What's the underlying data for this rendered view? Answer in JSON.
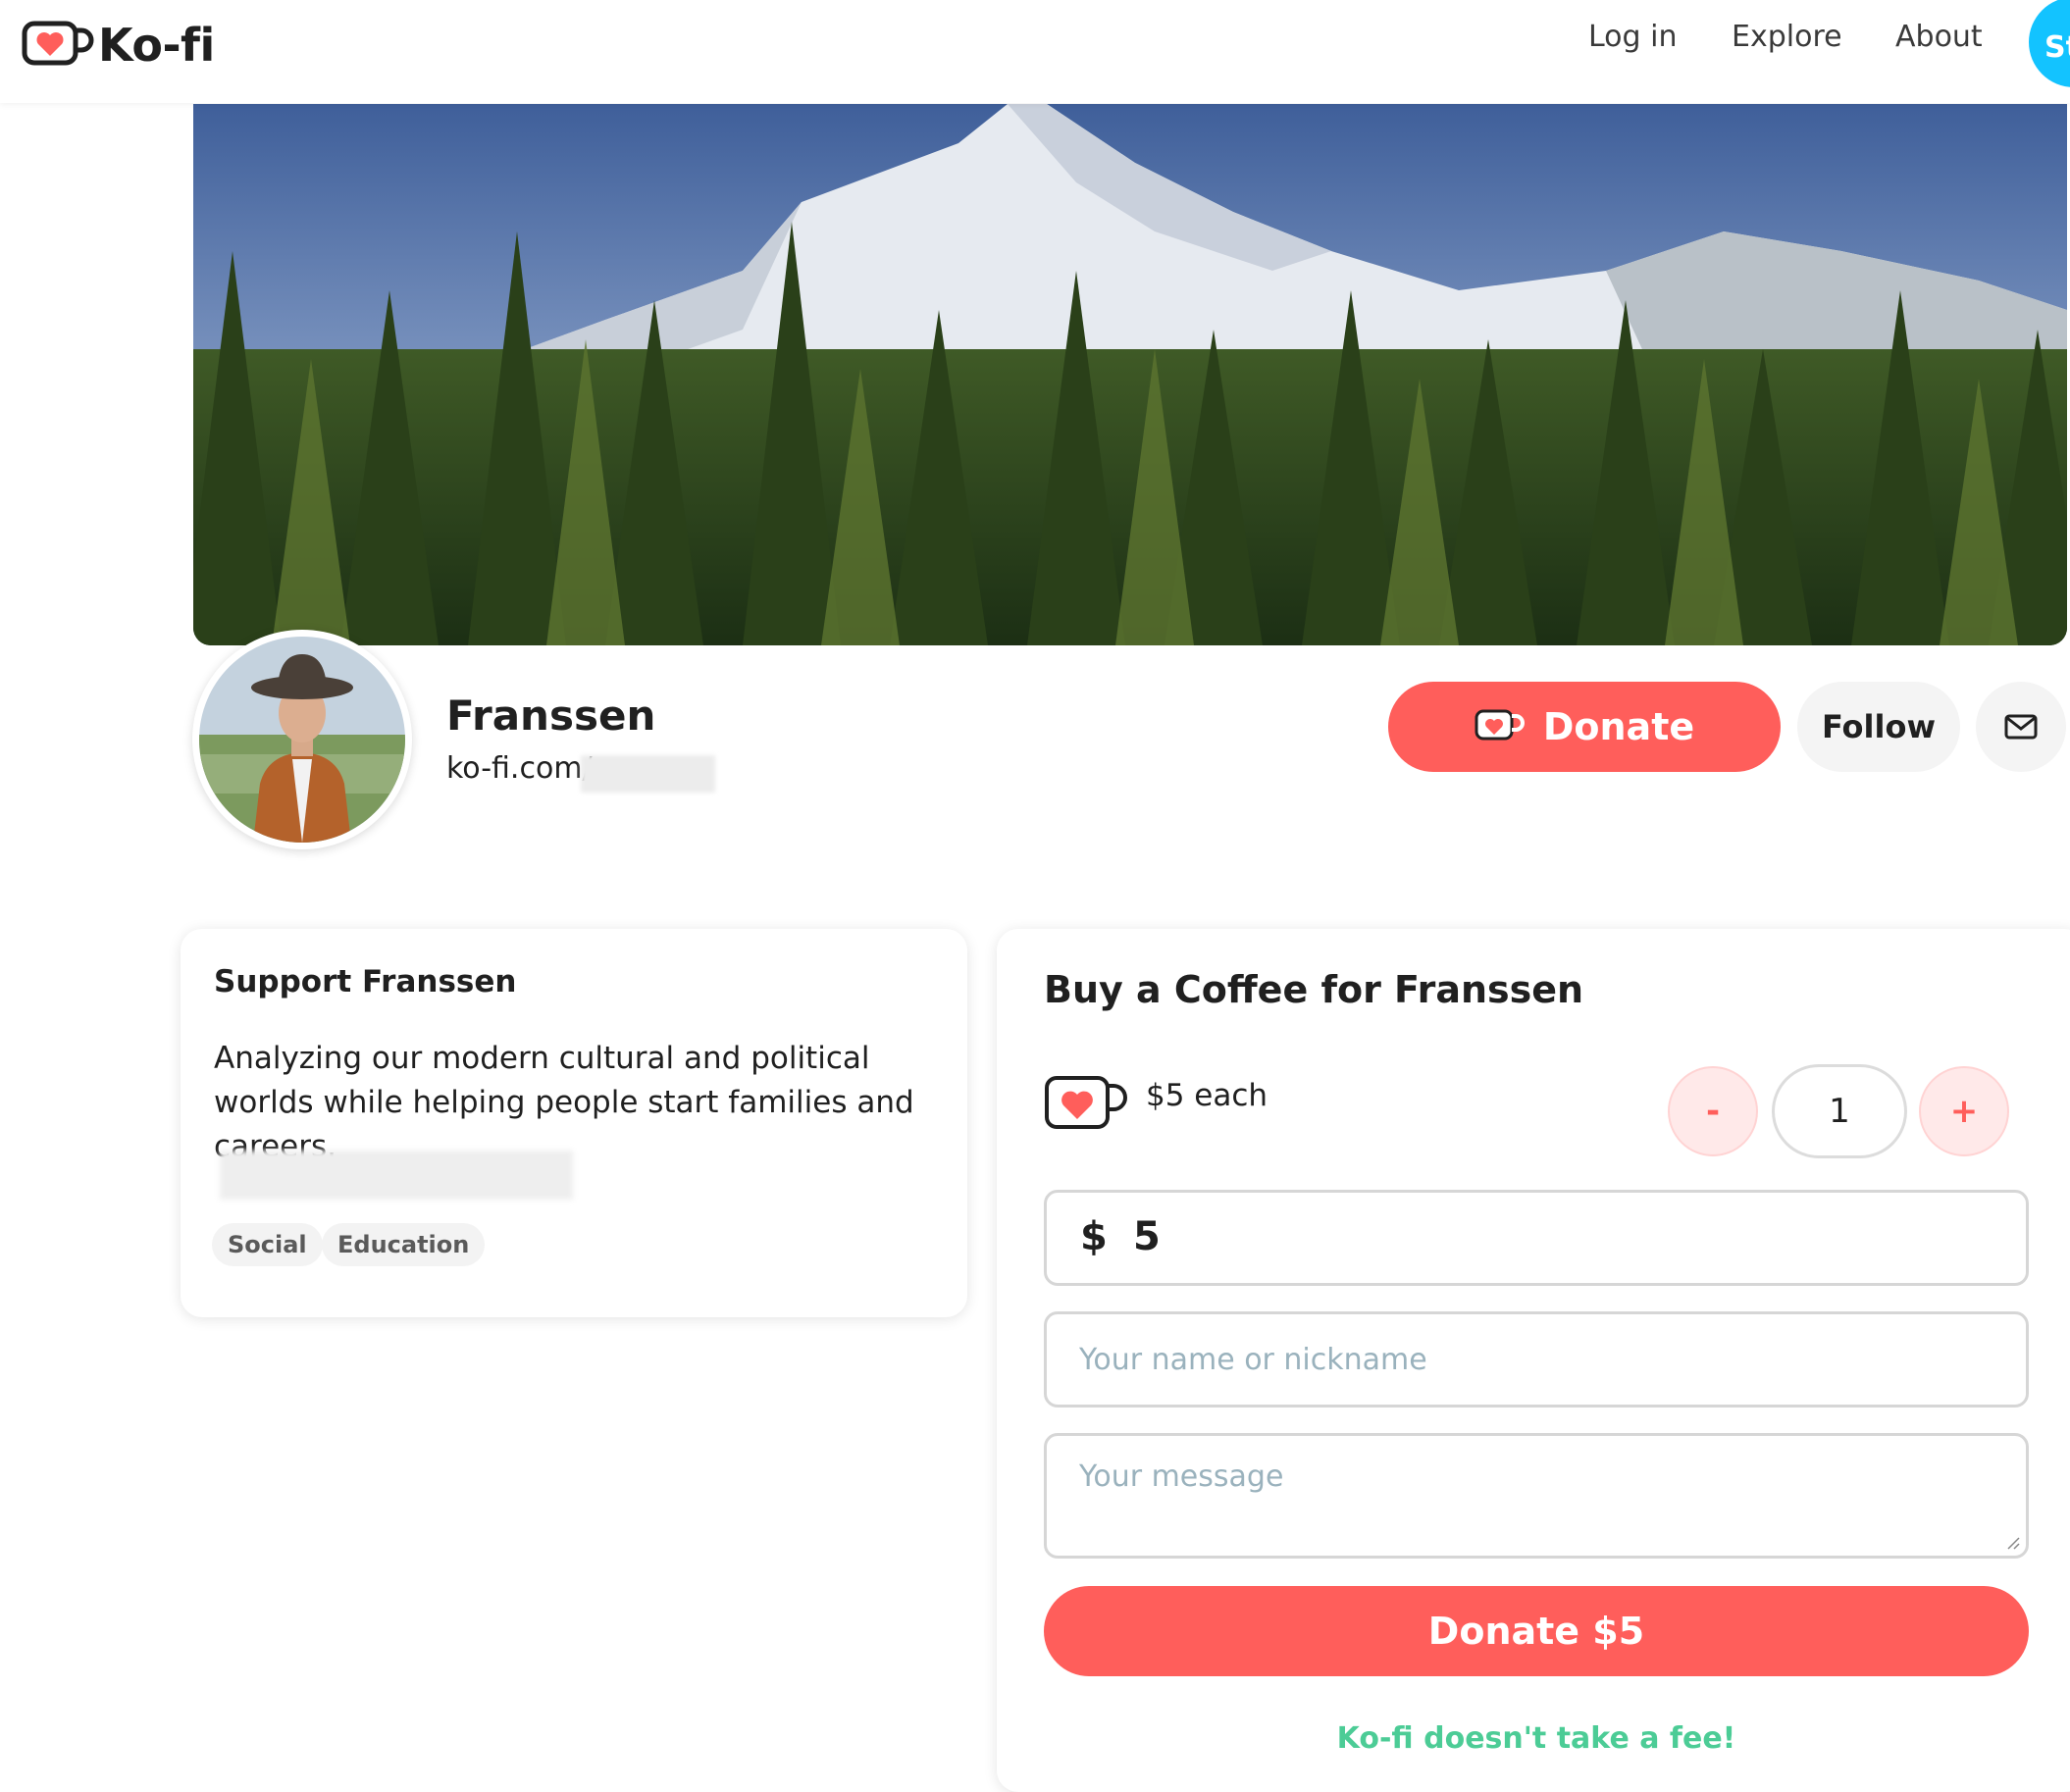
{
  "nav": {
    "logo_text": "Ko-fi",
    "login": "Log in",
    "explore": "Explore",
    "about": "About",
    "start_button": "St"
  },
  "profile": {
    "name": "Franssen",
    "url_prefix": "ko-fi.com/",
    "donate_label": "Donate",
    "follow_label": "Follow"
  },
  "support": {
    "title": "Support Franssen",
    "description": "Analyzing our modern cultural and political worlds while helping people start families and careers.",
    "tags": [
      "Social",
      "Education"
    ]
  },
  "coffee": {
    "title": "Buy a Coffee for Franssen",
    "price_each": "$5 each",
    "qty_minus": "-",
    "qty_value": "1",
    "qty_plus": "+",
    "currency_symbol": "$",
    "amount": "5",
    "name_placeholder": "Your name or nickname",
    "message_placeholder": "Your message",
    "donate_button": "Donate $5",
    "no_fee": "Ko-fi doesn't take a fee!"
  },
  "colors": {
    "brand_red": "#ff5e5b",
    "start_blue": "#13c3ff",
    "fee_green": "#4ccc96"
  }
}
